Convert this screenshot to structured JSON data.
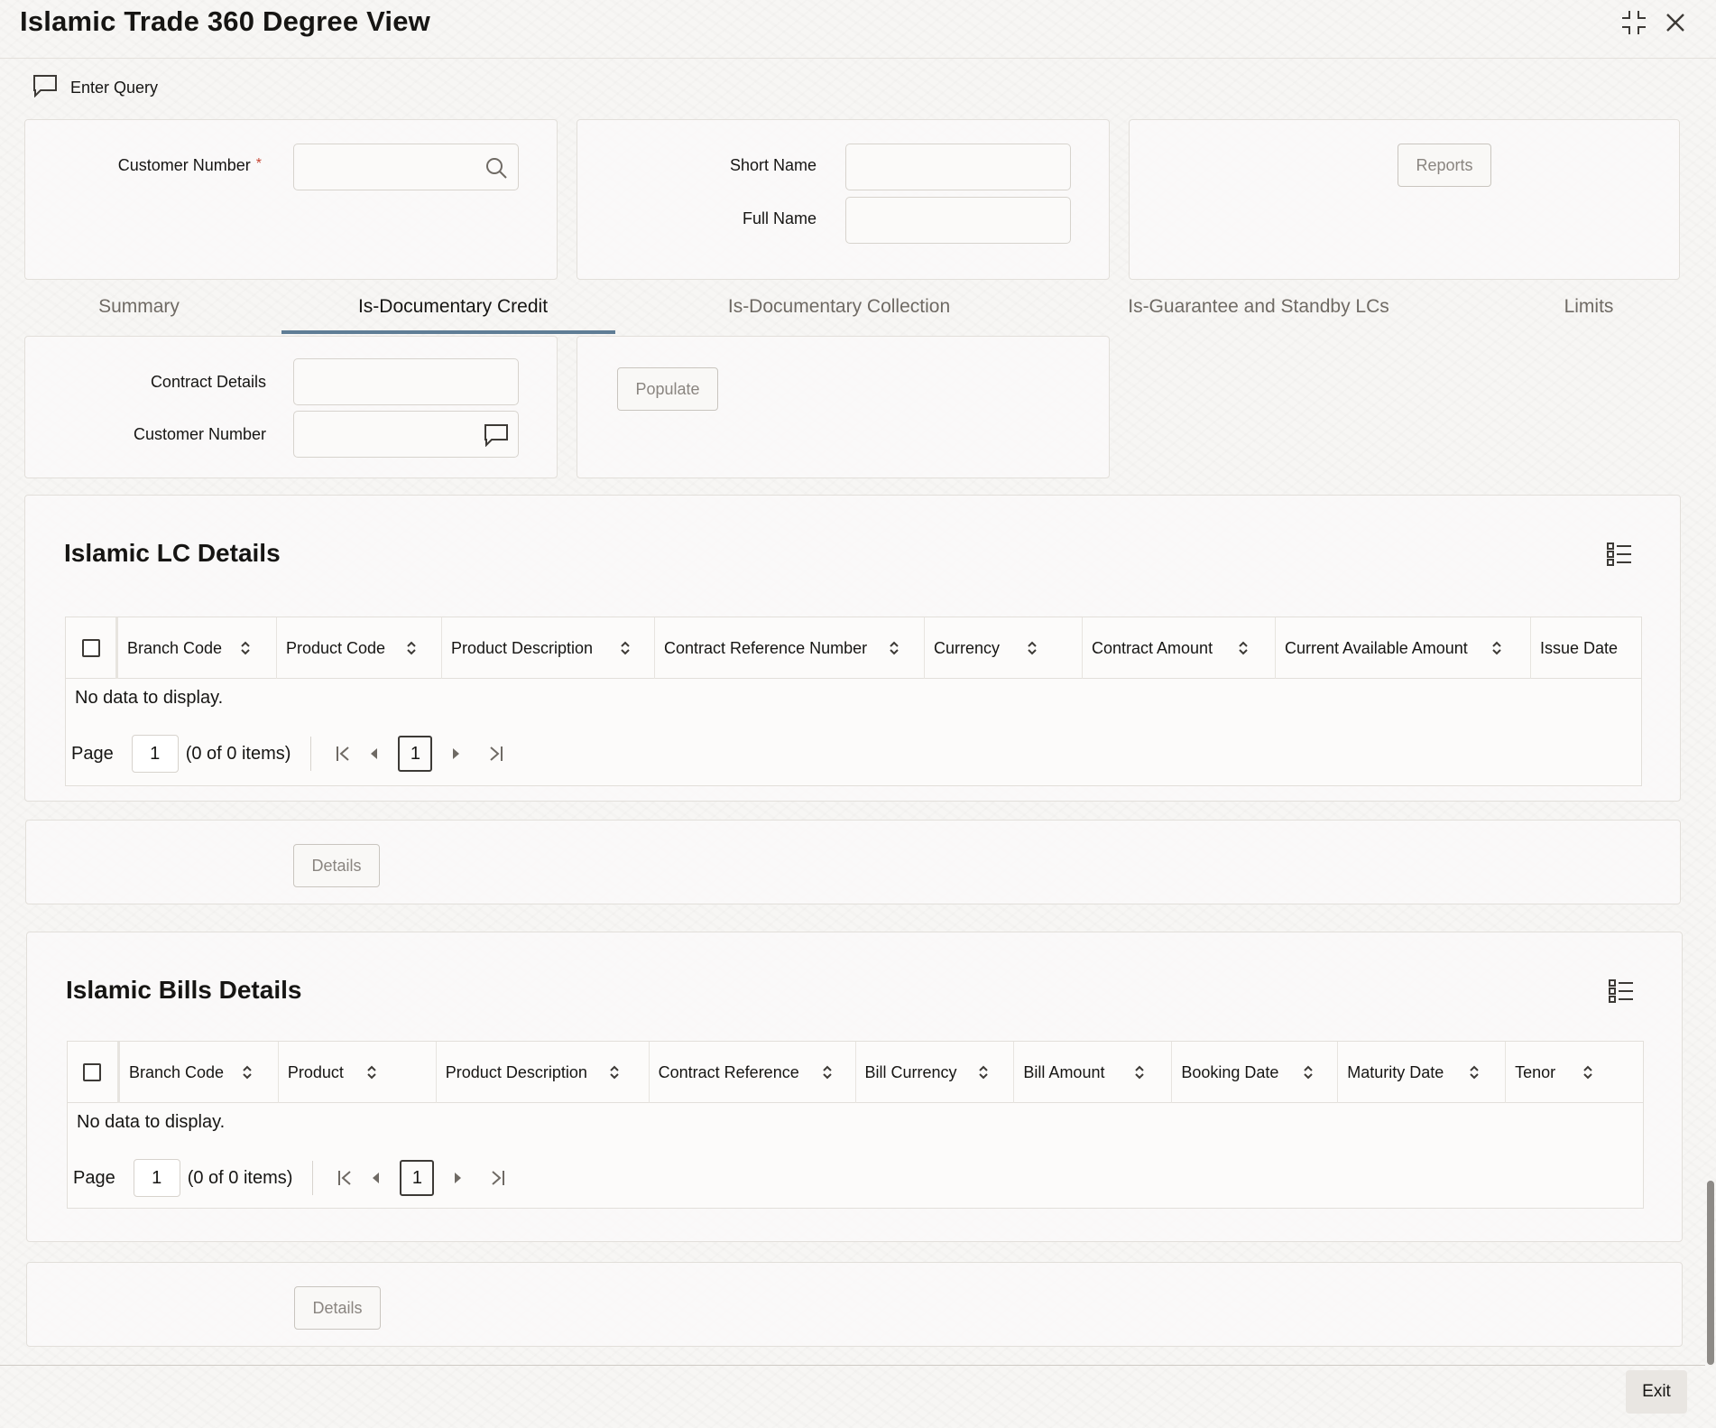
{
  "window": {
    "title": "Islamic Trade 360 Degree View",
    "controls": [
      "minimize-icon",
      "close-icon"
    ]
  },
  "toolbar": {
    "enter_query_label": "Enter Query"
  },
  "customer_panel": {
    "customer_number_label": "Customer Number",
    "required_marker": "*",
    "customer_number_value": ""
  },
  "name_panel": {
    "short_name_label": "Short Name",
    "short_name_value": "",
    "full_name_label": "Full Name",
    "full_name_value": ""
  },
  "reports_button": "Reports",
  "tabs": [
    {
      "label": "Summary",
      "active": false
    },
    {
      "label": "Is-Documentary Credit",
      "active": true
    },
    {
      "label": "Is-Documentary Collection",
      "active": false
    },
    {
      "label": "Is-Guarantee and Standby LCs",
      "active": false
    },
    {
      "label": "Limits",
      "active": false
    }
  ],
  "contract_panel": {
    "contract_details_label": "Contract Details",
    "contract_details_value": "",
    "customer_number_label": "Customer Number",
    "customer_number_value": ""
  },
  "populate_button": "Populate",
  "lc_section": {
    "title": "Islamic LC Details",
    "columns": [
      "Branch Code",
      "Product Code",
      "Product Description",
      "Contract Reference Number",
      "Currency",
      "Contract Amount",
      "Current Available Amount",
      "Issue Date"
    ],
    "empty_text": "No data to display.",
    "pager": {
      "page_label": "Page",
      "page_value": "1",
      "items_text": "(0 of 0 items)",
      "current_page": "1"
    },
    "details_button": "Details"
  },
  "bills_section": {
    "title": "Islamic Bills Details",
    "columns": [
      "Branch Code",
      "Product",
      "Product Description",
      "Contract Reference",
      "Bill Currency",
      "Bill Amount",
      "Booking Date",
      "Maturity Date",
      "Tenor"
    ],
    "empty_text": "No data to display.",
    "pager": {
      "page_label": "Page",
      "page_value": "1",
      "items_text": "(0 of 0 items)",
      "current_page": "1"
    },
    "details_button": "Details"
  },
  "exit_button": "Exit",
  "colors": {
    "accent_tab_underline": "#5f7d95",
    "required": "#c74634",
    "text": "#161513"
  }
}
